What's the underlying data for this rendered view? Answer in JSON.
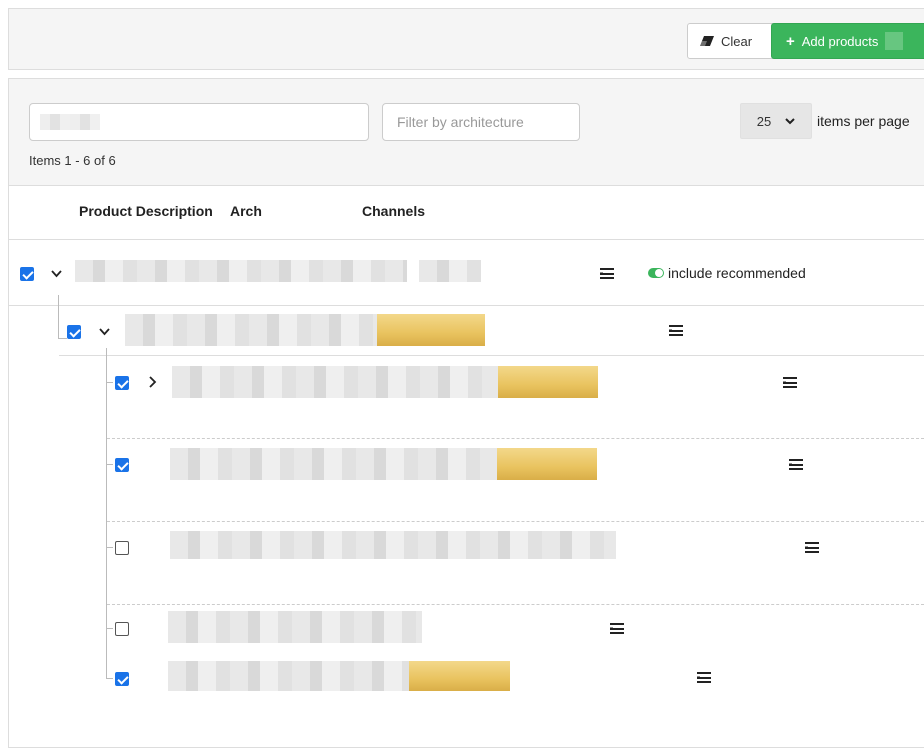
{
  "toolbar": {
    "clear_label": "Clear",
    "add_label": "Add products",
    "clear_icon": "eraser-icon",
    "add_icon": "plus-icon"
  },
  "filters": {
    "search_value": "",
    "arch_placeholder": "Filter by architecture",
    "per_page_value": "25",
    "per_page_label": "items per page",
    "items_count": "Items 1 - 6 of 6"
  },
  "columns": {
    "product_description": "Product Description",
    "arch": "Arch",
    "channels": "Channels"
  },
  "rows": [
    {
      "level": 0,
      "checked": true,
      "expander": "chevron-down",
      "recommended_label": "include recommended"
    },
    {
      "level": 1,
      "checked": true,
      "expander": "chevron-down"
    },
    {
      "level": 2,
      "checked": true,
      "expander": "chevron-right"
    },
    {
      "level": 2,
      "checked": true,
      "expander": ""
    },
    {
      "level": 2,
      "checked": false,
      "expander": ""
    },
    {
      "level": 2,
      "checked": false,
      "expander": ""
    },
    {
      "level": 2,
      "checked": true,
      "expander": ""
    }
  ],
  "colors": {
    "accent_green": "#3bb55c",
    "checkbox_blue": "#1a73e8",
    "header_bg": "#f5f5f5",
    "border": "#dddddd"
  }
}
